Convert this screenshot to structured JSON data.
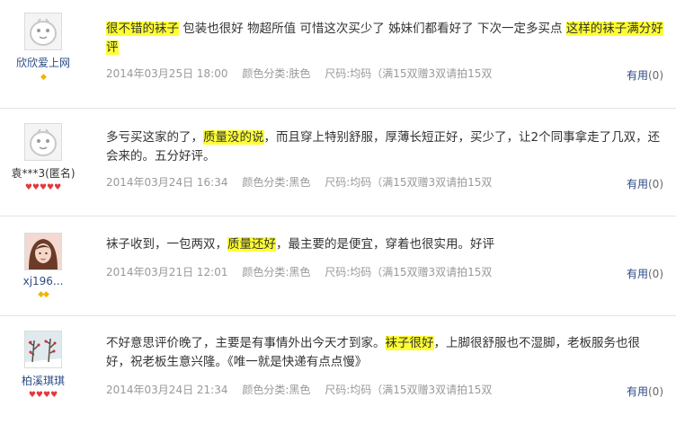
{
  "reviews": [
    {
      "username": "欣欣爱上网",
      "level": "◆",
      "parts": [
        "很不错的袜子",
        " 包装也很好 物超所值 可惜这次买少了 姊妹们都看好了 下次一定多买点 ",
        "这样的袜子满分好评",
        ""
      ],
      "date": "2014年03月25日 18:00",
      "color": "颜色分类:肤色",
      "size": "尺码:均码（满15双赠3双请拍15双",
      "useful_label": "有用",
      "useful_count": "(0)"
    },
    {
      "username": "袁***3(匿名)",
      "level": "♥♥♥♥♥",
      "parts": [
        "多亏买这家的了，",
        "质量没的说",
        "，而且穿上特别舒服，厚薄长短正好，买少了，让2个同事拿走了几双，还会来的。五分好评。",
        ""
      ],
      "date": "2014年03月24日 16:34",
      "color": "颜色分类:黑色",
      "size": "尺码:均码（满15双赠3双请拍15双",
      "useful_label": "有用",
      "useful_count": "(0)"
    },
    {
      "username": "xj196...",
      "level": "◆◆",
      "parts": [
        "袜子收到，一包两双，",
        "质量还好",
        "，最主要的是便宜，穿着也很实用。好评",
        ""
      ],
      "date": "2014年03月21日 12:01",
      "color": "颜色分类:黑色",
      "size": "尺码:均码（满15双赠3双请拍15双",
      "useful_label": "有用",
      "useful_count": "(0)"
    },
    {
      "username": "柏溪琪琪",
      "level": "♥♥♥♥",
      "parts": [
        "不好意思评价晚了，主要是有事情外出今天才到家。",
        "袜子很好",
        "，上脚很舒服也不湿脚，老板服务也很好，祝老板生意兴隆。《唯一就是快递有点点慢》",
        ""
      ],
      "date": "2014年03月24日 21:34",
      "color": "颜色分类:黑色",
      "size": "尺码:均码（满15双赠3双请拍15双",
      "useful_label": "有用",
      "useful_count": "(0)"
    }
  ],
  "icons": {
    "default_avatar": "ghost-avatar-icon",
    "photo_avatar": "user-photo-avatar",
    "tree_avatar": "snow-tree-avatar",
    "diamond": "diamond-level-icon",
    "heart": "heart-level-icon"
  },
  "colors": {
    "highlight": "#ffff33",
    "link": "#2b4b86",
    "meta": "#999999",
    "diamond": "#f0b400",
    "heart": "#e4393c"
  }
}
